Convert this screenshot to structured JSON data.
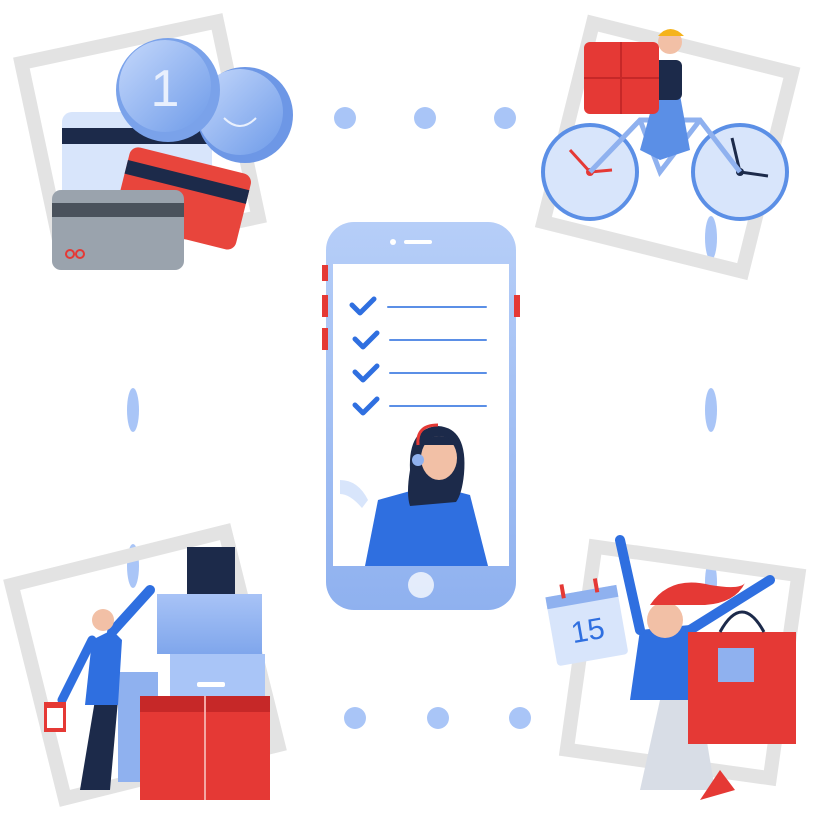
{
  "illustration": {
    "calendar_day": "15",
    "coin_symbol": "1",
    "colors": {
      "primary_blue": "#2f6fe0",
      "light_blue": "#a9c5f7",
      "pale_blue": "#d8e5fb",
      "red": "#e53935",
      "grey_frame": "#e3e3e3",
      "dark": "#1c2a4a"
    },
    "icons": [
      "coins-and-cards",
      "delivery-bicycle",
      "phone-checklist",
      "gift-boxes",
      "happy-shopper"
    ],
    "checklist_items": 4
  }
}
